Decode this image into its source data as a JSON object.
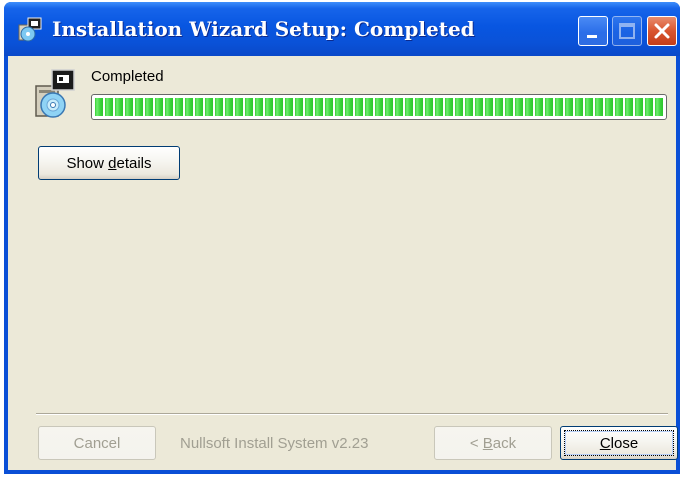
{
  "window": {
    "title": "Installation Wizard Setup: Completed",
    "icon": "installer-icon",
    "controls": [
      "minimize-icon",
      "maximize-icon",
      "close-icon"
    ]
  },
  "status": {
    "label": "Completed",
    "progress_percent": 100
  },
  "buttons": {
    "show_details": {
      "pre": "Show ",
      "accel": "d",
      "post": "etails"
    },
    "cancel": {
      "label": "Cancel",
      "enabled": false
    },
    "back": {
      "pre": "< ",
      "accel": "B",
      "post": "ack",
      "enabled": false
    },
    "close": {
      "pre": "",
      "accel": "C",
      "post": "lose",
      "enabled": true
    }
  },
  "branding": "Nullsoft Install System v2.23",
  "colors": {
    "titlebar": "#0a4fd6",
    "client_bg": "#ece9d8",
    "progress_green": "#2fd12f",
    "close_button": "#d9552f"
  }
}
